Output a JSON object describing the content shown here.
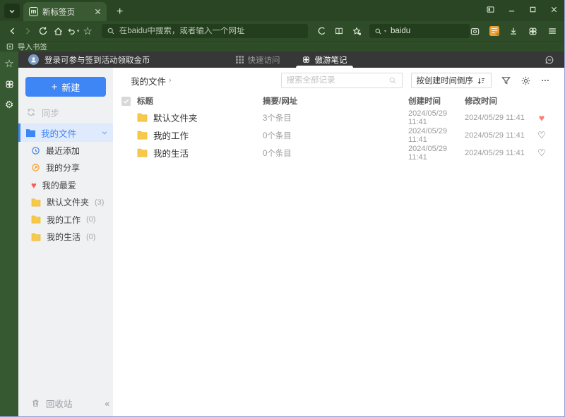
{
  "browser": {
    "tab_title": "新标签页",
    "url_placeholder": "在baidu中搜索，或者输入一个网址",
    "search_engine": "baidu",
    "import_bookmarks": "导入书签"
  },
  "app": {
    "header": {
      "login_text": "登录可参与签到活动领取金币",
      "tab_quick_access": "快速访问",
      "tab_notes": "傲游笔记"
    },
    "sidebar": {
      "new_label": "新建",
      "sync_label": "同步",
      "my_files_label": "我的文件",
      "items": [
        {
          "label": "最近添加",
          "count": "",
          "icon": "clock"
        },
        {
          "label": "我的分享",
          "count": "",
          "icon": "share"
        },
        {
          "label": "我的最爱",
          "count": "",
          "icon": "heart"
        },
        {
          "label": "默认文件夹",
          "count": "(3)",
          "icon": "folder"
        },
        {
          "label": "我的工作",
          "count": "(0)",
          "icon": "folder"
        },
        {
          "label": "我的生活",
          "count": "(0)",
          "icon": "folder"
        }
      ],
      "trash_label": "回收站",
      "collapse_glyph": "«"
    },
    "content": {
      "breadcrumb": "我的文件",
      "breadcrumb_arrow": "›",
      "search_placeholder": "搜索全部记录",
      "sort_label": "按创建时间倒序",
      "table": {
        "headers": {
          "title": "标题",
          "summary": "摘要/网址",
          "created": "创建时间",
          "modified": "修改时间"
        },
        "rows": [
          {
            "title": "默认文件夹",
            "summary": "3个条目",
            "created": "2024/05/29 11:41",
            "modified": "2024/05/29 11:41",
            "favorite": true
          },
          {
            "title": "我的工作",
            "summary": "0个条目",
            "created": "2024/05/29 11:41",
            "modified": "2024/05/29 11:41",
            "favorite": false
          },
          {
            "title": "我的生活",
            "summary": "0个条目",
            "created": "2024/05/29 11:41",
            "modified": "2024/05/29 11:41",
            "favorite": false
          }
        ]
      }
    }
  },
  "colors": {
    "theme_green_dark": "#2a4523",
    "theme_green": "#2e4c27",
    "field_green": "#233e1d",
    "rail_green": "#375931",
    "header_dark": "#373737",
    "accent_blue": "#3e86f5",
    "selected_bg": "#dfeafd",
    "heart_red": "#f88078",
    "folder_yellow": "#f7c948",
    "note_orange": "#f0a030"
  }
}
